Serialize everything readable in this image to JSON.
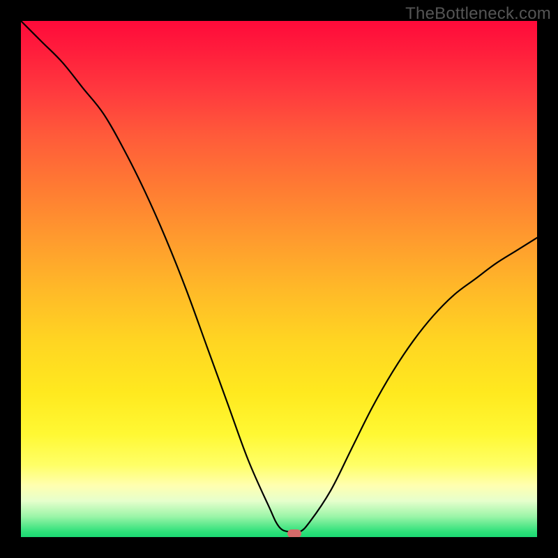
{
  "watermark": "TheBottleneck.com",
  "colors": {
    "curve_stroke": "#000000",
    "marker_fill": "#d66a6a",
    "background_black": "#000000"
  },
  "chart_data": {
    "type": "line",
    "title": "",
    "xlabel": "",
    "ylabel": "",
    "xlim": [
      0,
      100
    ],
    "ylim": [
      0,
      100
    ],
    "x": [
      0,
      4,
      8,
      12,
      16,
      20,
      24,
      28,
      32,
      36,
      40,
      44,
      48,
      50,
      52,
      54,
      56,
      60,
      64,
      68,
      72,
      76,
      80,
      84,
      88,
      92,
      96,
      100
    ],
    "values": [
      100,
      96,
      92,
      87,
      82,
      75,
      67,
      58,
      48,
      37,
      26,
      15,
      6,
      2,
      1,
      1,
      3,
      9,
      17,
      25,
      32,
      38,
      43,
      47,
      50,
      53,
      55.5,
      58
    ],
    "min_point": {
      "x": 53,
      "y": 0.5
    },
    "flat_min_range": [
      50,
      55
    ],
    "notes": "V-shaped bottleneck curve. Left branch steeper and taller; right branch asymptotes below 60%. Gradient background encodes 0 (green, bottom) to 100 (red, top)."
  }
}
